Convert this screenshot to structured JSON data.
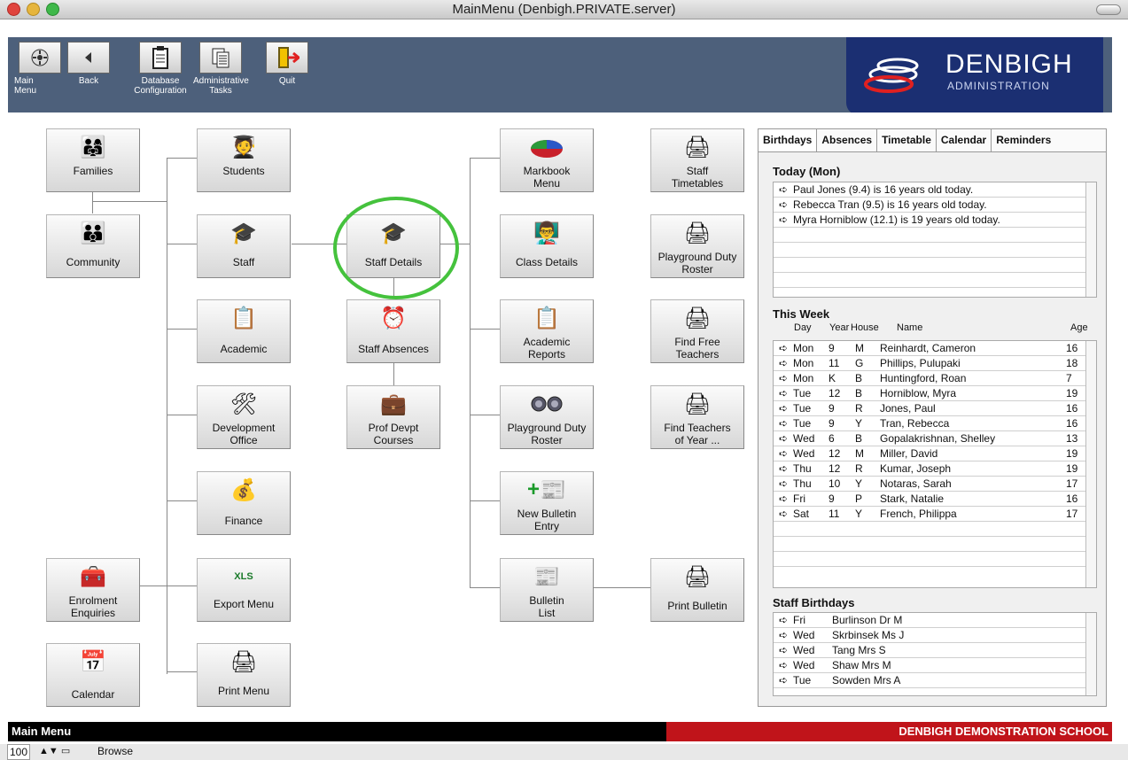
{
  "window": {
    "title": "MainMenu (Denbigh.PRIVATE.server)"
  },
  "toolbar": {
    "buttons": [
      {
        "label": "Main\nMenu",
        "icon": "main-menu-icon"
      },
      {
        "label": "Back",
        "icon": "back-icon"
      },
      {
        "label": "Database\nConfiguration",
        "icon": "clipboard-icon"
      },
      {
        "label": "Administrative\nTasks",
        "icon": "documents-icon"
      },
      {
        "label": "Quit",
        "icon": "exit-door-icon"
      }
    ]
  },
  "logo": {
    "name": "DENBIGH",
    "sub": "ADMINISTRATION"
  },
  "menu": {
    "families": "Families",
    "community": "Community",
    "students": "Students",
    "staff": "Staff",
    "academic": "Academic",
    "development_office": "Development\nOffice",
    "finance": "Finance",
    "enrolment_enquiries": "Enrolment\nEnquiries",
    "export_menu": "Export Menu",
    "calendar": "Calendar",
    "print_menu": "Print Menu",
    "staff_details": "Staff Details",
    "staff_absences": "Staff Absences",
    "prof_devpt": "Prof Devpt\nCourses",
    "markbook_menu": "Markbook\nMenu",
    "class_details": "Class Details",
    "academic_reports": "Academic\nReports",
    "playground_roster_mid": "Playground Duty\nRoster",
    "new_bulletin": "New Bulletin\nEntry",
    "bulletin_list": "Bulletin\nList",
    "staff_timetables": "Staff\nTimetables",
    "playground_roster_right": "Playground Duty\nRoster",
    "find_free_teachers": "Find Free\nTeachers",
    "find_teachers_year": "Find Teachers\nof Year ...",
    "print_bulletin": "Print Bulletin"
  },
  "panel": {
    "tabs": [
      "Birthdays",
      "Absences",
      "Timetable",
      "Calendar",
      "Reminders"
    ],
    "today_title": "Today (Mon)",
    "today": [
      "Paul Jones (9.4) is 16 years old today.",
      "Rebecca Tran (9.5) is 16 years old today.",
      "Myra Horniblow (12.1) is 19 years old today."
    ],
    "week_title": "This Week",
    "week_headers": {
      "day": "Day",
      "year": "Year",
      "house": "House",
      "name": "Name",
      "age": "Age"
    },
    "week": [
      {
        "day": "Mon",
        "year": "9",
        "house": "M",
        "name": "Reinhardt, Cameron",
        "age": "16"
      },
      {
        "day": "Mon",
        "year": "11",
        "house": "G",
        "name": "Phillips, Pulupaki",
        "age": "18"
      },
      {
        "day": "Mon",
        "year": "K",
        "house": "B",
        "name": "Huntingford, Roan",
        "age": "7"
      },
      {
        "day": "Tue",
        "year": "12",
        "house": "B",
        "name": "Horniblow, Myra",
        "age": "19"
      },
      {
        "day": "Tue",
        "year": "9",
        "house": "R",
        "name": "Jones, Paul",
        "age": "16"
      },
      {
        "day": "Tue",
        "year": "9",
        "house": "Y",
        "name": "Tran, Rebecca",
        "age": "16"
      },
      {
        "day": "Wed",
        "year": "6",
        "house": "B",
        "name": "Gopalakrishnan, Shelley",
        "age": "13"
      },
      {
        "day": "Wed",
        "year": "12",
        "house": "M",
        "name": "Miller, David",
        "age": "19"
      },
      {
        "day": "Thu",
        "year": "12",
        "house": "R",
        "name": "Kumar, Joseph",
        "age": "19"
      },
      {
        "day": "Thu",
        "year": "10",
        "house": "Y",
        "name": "Notaras, Sarah",
        "age": "17"
      },
      {
        "day": "Fri",
        "year": "9",
        "house": "P",
        "name": "Stark, Natalie",
        "age": "16"
      },
      {
        "day": "Sat",
        "year": "11",
        "house": "Y",
        "name": "French, Philippa",
        "age": "17"
      }
    ],
    "staff_title": "Staff Birthdays",
    "staff": [
      {
        "day": "Fri",
        "name": "Burlinson Dr M"
      },
      {
        "day": "Wed",
        "name": "Skrbinsek Ms J"
      },
      {
        "day": "Wed",
        "name": "Tang Mrs S"
      },
      {
        "day": "Wed",
        "name": "Shaw Mrs M"
      },
      {
        "day": "Tue",
        "name": "Sowden Mrs A"
      }
    ]
  },
  "status": {
    "left": "Main Menu",
    "right": "DENBIGH DEMONSTRATION SCHOOL"
  },
  "bottom": {
    "zoom": "100",
    "mode": "Browse"
  },
  "colors": {
    "toolbar": "#4d607b",
    "logo_bg": "#1b2f72",
    "status_red": "#c0141a",
    "highlight_circle": "#45c23d"
  }
}
